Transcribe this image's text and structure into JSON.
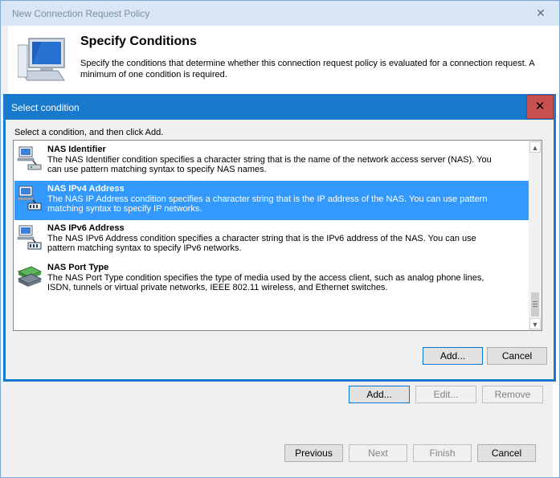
{
  "wizard": {
    "title": "New Connection Request Policy",
    "close_glyph": "✕",
    "heading": "Specify Conditions",
    "description_lines": [
      "Specify the conditions that determine whether this connection request policy is evaluated for a connection request. A",
      "minimum of one condition is required."
    ],
    "condition_buttons": {
      "add": "Add...",
      "edit": "Edit...",
      "remove": "Remove"
    },
    "nav_buttons": {
      "previous": "Previous",
      "next": "Next",
      "finish": "Finish",
      "cancel": "Cancel"
    }
  },
  "dialog": {
    "title": "Select condition",
    "close_glyph": "✕",
    "instruction": "Select a condition, and then click Add.",
    "conditions": [
      {
        "name": "NAS Identifier",
        "icon": "network-identifier-icon",
        "desc_lines": [
          "The NAS Identifier condition specifies a character string that is the name of the network access server (NAS). You",
          "can use pattern matching syntax to specify NAS names."
        ]
      },
      {
        "name": "NAS IPv4 Address",
        "icon": "network-ipv4-icon",
        "desc_lines": [
          "The NAS IP Address condition specifies a character string that is the IP address of the NAS. You can use pattern",
          "matching syntax to specify IP networks."
        ]
      },
      {
        "name": "NAS IPv6 Address",
        "icon": "network-ipv6-icon",
        "desc_lines": [
          "The NAS IPv6 Address condition specifies a character string that is the IPv6 address of the NAS. You can use",
          "pattern matching syntax to specify IPv6 networks."
        ]
      },
      {
        "name": "NAS Port Type",
        "icon": "port-type-icon",
        "desc_lines": [
          "The NAS Port Type condition specifies the type of media used by the access client, such as analog phone lines,",
          "ISDN, tunnels or virtual private networks, IEEE 802.11 wireless, and Ethernet switches."
        ]
      }
    ],
    "selected_index": 1,
    "add_label": "Add...",
    "cancel_label": "Cancel"
  }
}
